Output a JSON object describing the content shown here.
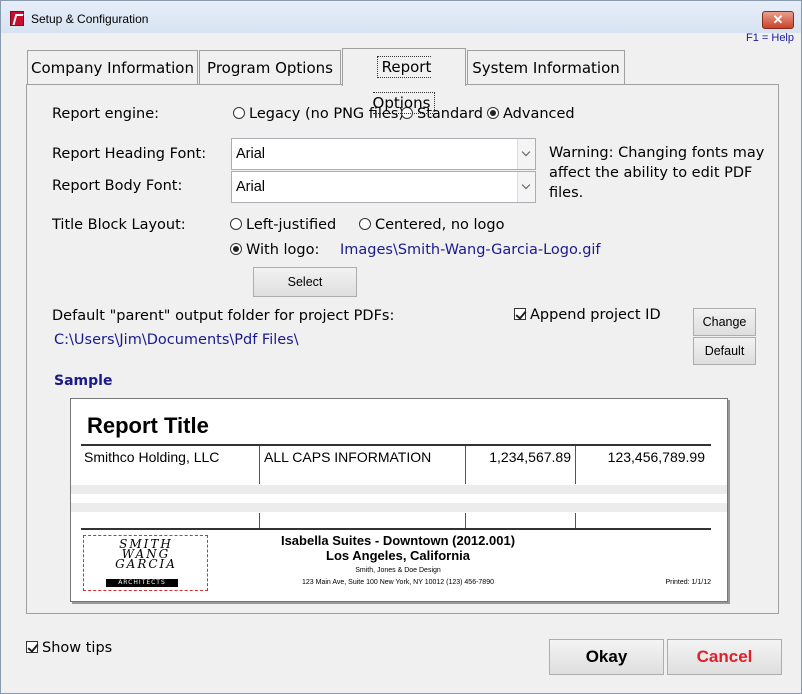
{
  "window": {
    "title": "Setup & Configuration",
    "help": "F1 = Help",
    "close": "✕"
  },
  "tabs": [
    "Company Information",
    "Program Options",
    "Report Options",
    "System Information"
  ],
  "report_engine": {
    "label": "Report engine:",
    "options": [
      "Legacy (no PNG files)",
      "Standard",
      "Advanced"
    ],
    "selected": "Advanced"
  },
  "fonts": {
    "heading_label": "Report Heading Font:",
    "heading_value": "Arial",
    "body_label": "Report Body Font:",
    "body_value": "Arial",
    "warning": [
      "Warning: Changing fonts may",
      "affect the ability to edit PDF",
      "files."
    ]
  },
  "title_block": {
    "label": "Title Block Layout:",
    "left": "Left-justified",
    "centered": "Centered, no logo",
    "with_logo": "With logo:",
    "selected": "With logo:",
    "logo_path": "Images\\Smith-Wang-Garcia-Logo.gif",
    "select_button": "Select"
  },
  "output": {
    "label": "Default \"parent\" output folder for project PDFs:",
    "path": "C:\\Users\\Jim\\Documents\\Pdf Files\\",
    "append_label": "Append project ID",
    "append_checked": true,
    "change_button": "Change",
    "default_button": "Default"
  },
  "sample": {
    "label": "Sample",
    "report_title": "Report Title",
    "row": [
      "Smithco Holding, LLC",
      "ALL CAPS INFORMATION",
      "1,234,567.89",
      "123,456,789.99"
    ],
    "project": "Isabella Suites - Downtown (2012.001)",
    "location": "Los Angeles, California",
    "firm": "Smith, Jones & Doe Design",
    "address": "123 Main Ave, Suite 100   New York, NY 10012    (123) 456-7890",
    "printed": "Printed: 1/1/12",
    "logo_lines": [
      "SMITH",
      "WANG",
      "GARCIA"
    ],
    "logo_tag": "ARCHITECTS"
  },
  "show_tips": {
    "label": "Show tips",
    "checked": true
  },
  "buttons": {
    "okay": "Okay",
    "cancel": "Cancel"
  },
  "colors": {
    "link_blue": "#1a1a8c",
    "cancel_red": "#e0202a"
  }
}
